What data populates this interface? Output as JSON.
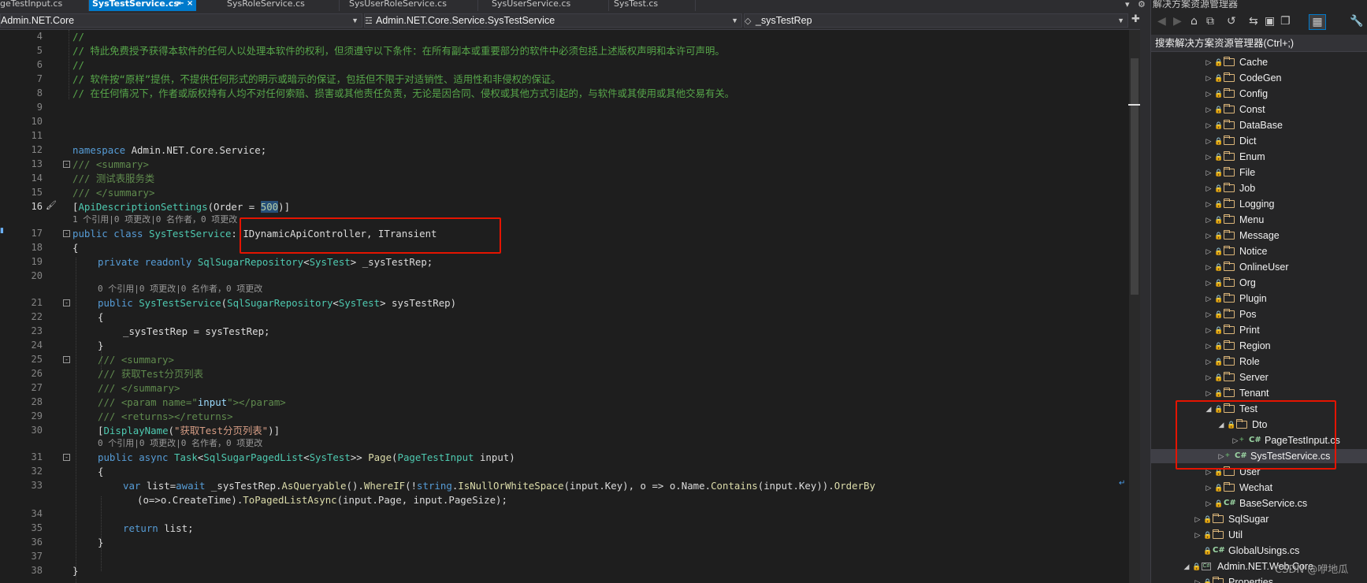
{
  "tabs": [
    {
      "label": "geTestInput.cs"
    },
    {
      "label": "SysTestService.cs",
      "active": true
    },
    {
      "label": "SysRoleService.cs"
    },
    {
      "label": "SysUserRoleService.cs"
    },
    {
      "label": "SysUserService.cs"
    },
    {
      "label": "SysTest.cs"
    }
  ],
  "tab_pin_glyph": "⇤ ×",
  "tab_controls": {
    "dropdown": "▾",
    "settings": "⚙"
  },
  "navbar": {
    "project": "Admin.NET.Core",
    "type": "Admin.NET.Core.Service.SysTestService",
    "member": "_sysTestRep"
  },
  "editor": {
    "lines": [
      {
        "num": "4",
        "text": "//"
      },
      {
        "num": "5",
        "text": "// 特此免费授予获得本软件的任何人以处理本软件的权利，但须遵守以下条件：在所有副本或重要部分的软件中必须包括上述版权声明和本许可声明。"
      },
      {
        "num": "6",
        "text": "//"
      },
      {
        "num": "7",
        "text": "// 软件按“原样”提供，不提供任何形式的明示或暗示的保证，包括但不限于对适销性、适用性和非侵权的保证。"
      },
      {
        "num": "8",
        "text": "// 在任何情况下，作者或版权持有人均不对任何索赔、损害或其他责任负责，无论是因合同、侵权或其他方式引起的，与软件或其使用或其他交易有关。"
      },
      {
        "num": "9",
        "text": ""
      },
      {
        "num": "10",
        "text": ""
      },
      {
        "num": "11",
        "text": ""
      },
      {
        "num": "12",
        "namespace_kw": "namespace",
        "namespace_name": " Admin.NET.Core.Service;"
      },
      {
        "num": "13",
        "text": "/// <summary>"
      },
      {
        "num": "14",
        "text": "/// 测试表服务类"
      },
      {
        "num": "15",
        "text": "/// </summary>"
      },
      {
        "num": "16",
        "pre": "[",
        "attr": "ApiDescriptionSettings",
        "mid": "(Order = ",
        "num_val": "500",
        "post": ")]"
      },
      {
        "num": "17",
        "kw": "public class ",
        "cls": "SysTestService",
        "rest": ": IDynamicApiController, ITransient"
      },
      {
        "num": "18",
        "text": "{"
      },
      {
        "num": "19",
        "kw": "private readonly ",
        "ty1": "SqlSugarRepository",
        "lt": "<",
        "ty2": "SysTest",
        "rest": "> _sysTestRep;"
      },
      {
        "num": "20",
        "text": ""
      },
      {
        "num": "21",
        "kw": "public ",
        "cls": "SysTestService",
        "open": "(",
        "ty1": "SqlSugarRepository",
        "lt": "<",
        "ty2": "SysTest",
        "rest": "> sysTestRep)"
      },
      {
        "num": "22",
        "text": "{"
      },
      {
        "num": "23",
        "text": "_sysTestRep = sysTestRep;"
      },
      {
        "num": "24",
        "text": "}"
      },
      {
        "num": "25",
        "text": "/// <summary>"
      },
      {
        "num": "26",
        "text": "/// 获取Test分页列表"
      },
      {
        "num": "27",
        "text": "/// </summary>"
      },
      {
        "num": "28",
        "a": "/// <param name=\"",
        "b": "input",
        "c": "\"></param>"
      },
      {
        "num": "29",
        "text": "/// <returns></returns>"
      },
      {
        "num": "30",
        "a": "[",
        "b": "DisplayName",
        "c": "(",
        "d": "\"获取Test分页列表\"",
        "e": ")]"
      },
      {
        "num": "31",
        "kw": "public async ",
        "ty1": "Task",
        "lt1": "<",
        "ty2": "SqlSugarPagedList",
        "lt2": "<",
        "ty3": "SysTest",
        "rest1": ">> ",
        "meth": "Page",
        "open": "(",
        "ty4": "PageTestInput",
        "rest": " input)"
      },
      {
        "num": "32",
        "text": "{"
      },
      {
        "num": "33",
        "kw": "var",
        "a": " list=",
        "kw2": "await",
        "b": " _sysTestRep.",
        "m1": "AsQueryable",
        "c": "().",
        "m2": "WhereIF",
        "d": "(!",
        "kw3": "string",
        "e": ".",
        "m3": "IsNullOrWhiteSpace",
        "f": "(input.Key), o => o.Name.",
        "m4": "Contains",
        "g": "(input.Key)).",
        "m5": "OrderBy"
      },
      {
        "num": "",
        "a": "(o=>o.CreateTime).",
        "m1": "ToPagedListAsync",
        "b": "(input.Page, input.PageSize);"
      },
      {
        "num": "34",
        "text": ""
      },
      {
        "num": "35",
        "kw": "return",
        "rest": " list;"
      },
      {
        "num": "36",
        "text": "}"
      },
      {
        "num": "37",
        "text": ""
      },
      {
        "num": "38",
        "text": "}"
      }
    ],
    "codelens": {
      "class_ref": "1 个引用|0 项更改|0 名作者，0 项更改",
      "ctor_ref": "0 个引用|0 项更改|0 名作者，0 项更改",
      "page_ref": "0 个引用|0 项更改|0 名作者，0 项更改"
    }
  },
  "solution_explorer": {
    "title": "解决方案资源管理器",
    "search_placeholder": "搜索解决方案资源管理器(Ctrl+;)",
    "toolbar_icons": [
      "back-icon",
      "forward-icon",
      "home-icon",
      "sync-icon",
      "pending-changes-icon",
      "collapse-all-icon",
      "show-all-files-icon",
      "properties-icon",
      "preview-icon",
      "settings-icon"
    ],
    "items": [
      {
        "label": "Cache",
        "kind": "folder",
        "depth": 2,
        "expander": "▷"
      },
      {
        "label": "CodeGen",
        "kind": "folder",
        "depth": 2,
        "expander": "▷"
      },
      {
        "label": "Config",
        "kind": "folder",
        "depth": 2,
        "expander": "▷"
      },
      {
        "label": "Const",
        "kind": "folder",
        "depth": 2,
        "expander": "▷"
      },
      {
        "label": "DataBase",
        "kind": "folder",
        "depth": 2,
        "expander": "▷"
      },
      {
        "label": "Dict",
        "kind": "folder",
        "depth": 2,
        "expander": "▷"
      },
      {
        "label": "Enum",
        "kind": "folder",
        "depth": 2,
        "expander": "▷"
      },
      {
        "label": "File",
        "kind": "folder",
        "depth": 2,
        "expander": "▷"
      },
      {
        "label": "Job",
        "kind": "folder",
        "depth": 2,
        "expander": "▷"
      },
      {
        "label": "Logging",
        "kind": "folder",
        "depth": 2,
        "expander": "▷"
      },
      {
        "label": "Menu",
        "kind": "folder",
        "depth": 2,
        "expander": "▷"
      },
      {
        "label": "Message",
        "kind": "folder",
        "depth": 2,
        "expander": "▷"
      },
      {
        "label": "Notice",
        "kind": "folder",
        "depth": 2,
        "expander": "▷"
      },
      {
        "label": "OnlineUser",
        "kind": "folder",
        "depth": 2,
        "expander": "▷"
      },
      {
        "label": "Org",
        "kind": "folder",
        "depth": 2,
        "expander": "▷"
      },
      {
        "label": "Plugin",
        "kind": "folder",
        "depth": 2,
        "expander": "▷"
      },
      {
        "label": "Pos",
        "kind": "folder",
        "depth": 2,
        "expander": "▷"
      },
      {
        "label": "Print",
        "kind": "folder",
        "depth": 2,
        "expander": "▷"
      },
      {
        "label": "Region",
        "kind": "folder",
        "depth": 2,
        "expander": "▷"
      },
      {
        "label": "Role",
        "kind": "folder",
        "depth": 2,
        "expander": "▷"
      },
      {
        "label": "Server",
        "kind": "folder",
        "depth": 2,
        "expander": "▷"
      },
      {
        "label": "Tenant",
        "kind": "folder",
        "depth": 2,
        "expander": "▷"
      },
      {
        "label": "Test",
        "kind": "folder",
        "depth": 2,
        "expander": "◢"
      },
      {
        "label": "Dto",
        "kind": "folder",
        "depth": 3,
        "expander": "◢"
      },
      {
        "label": "PageTestInput.cs",
        "kind": "cs",
        "depth": 4,
        "expander": "▷",
        "added": true
      },
      {
        "label": "SysTestService.cs",
        "kind": "cs",
        "depth": 3,
        "expander": "▷",
        "added": true,
        "selected": true
      },
      {
        "label": "User",
        "kind": "folder",
        "depth": 2,
        "expander": "▷"
      },
      {
        "label": "Wechat",
        "kind": "folder",
        "depth": 2,
        "expander": "▷"
      },
      {
        "label": "BaseService.cs",
        "kind": "cs",
        "depth": 2,
        "expander": "▷"
      },
      {
        "label": "SqlSugar",
        "kind": "folder",
        "depth": 1,
        "expander": "▷"
      },
      {
        "label": "Util",
        "kind": "folder",
        "depth": 1,
        "expander": "▷"
      },
      {
        "label": "GlobalUsings.cs",
        "kind": "cs",
        "depth": 1,
        "expander": ""
      },
      {
        "label": "Admin.NET.Web.Core",
        "kind": "project",
        "depth": 0,
        "expander": "◢"
      },
      {
        "label": "Properties",
        "kind": "folder",
        "depth": 1,
        "expander": "▷"
      }
    ]
  },
  "watermark": "CSDN @咿地瓜"
}
